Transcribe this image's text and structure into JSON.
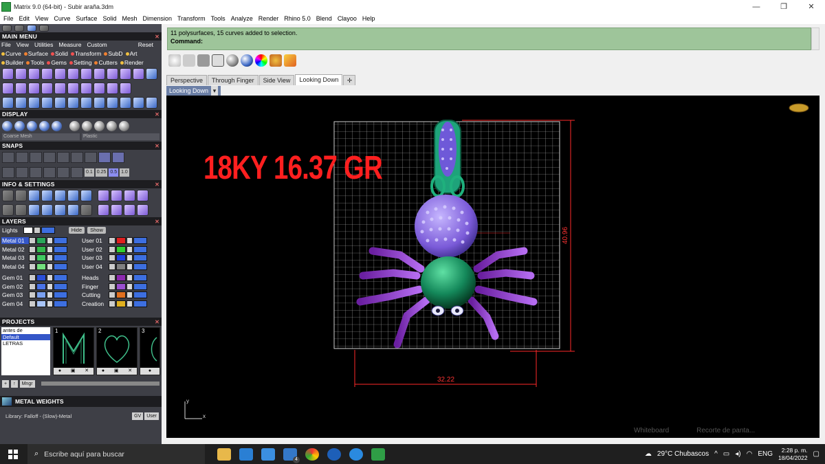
{
  "window": {
    "title": "Matrix 9.0 (64-bit) - Subir araña.3dm",
    "minimize": "—",
    "maximize": "❐",
    "close": "✕"
  },
  "menubar": [
    "File",
    "Edit",
    "View",
    "Curve",
    "Surface",
    "Solid",
    "Mesh",
    "Dimension",
    "Transform",
    "Tools",
    "Analyze",
    "Render",
    "Rhino 5.0",
    "Blend",
    "Clayoo",
    "Help"
  ],
  "left": {
    "main_menu_title": "MAIN MENU",
    "main_menu_row": [
      "File",
      "View",
      "Utilities",
      "Measure",
      "Custom"
    ],
    "reset": "Reset",
    "chips1": [
      "Curve",
      "Surface",
      "Solid",
      "Transform",
      "SubD",
      "Art"
    ],
    "chips2": [
      "Builder",
      "Tools",
      "Gems",
      "Setting",
      "Cutters",
      "Render"
    ],
    "display_title": "DISPLAY",
    "display_select1": "Coarse Mesh",
    "display_select2": "Plastic",
    "snaps_title": "SNAPS",
    "snap_values": [
      "0.1",
      "0.25",
      "0.5",
      "1.0"
    ],
    "info_title": "INFO & SETTINGS",
    "layers_title": "LAYERS",
    "lights": "Lights",
    "hide": "Hide",
    "show": "Show",
    "layers_left": [
      {
        "name": "Metal 01",
        "color": "#2aa65a",
        "sel": true
      },
      {
        "name": "Metal 02",
        "color": "#32b74c",
        "sel": false
      },
      {
        "name": "Metal 03",
        "color": "#3fc960",
        "sel": false
      },
      {
        "name": "Metal 04",
        "color": "#73e07d",
        "sel": false
      },
      {
        "name": "Gem 01",
        "color": "#2a4fd8",
        "sel": false
      },
      {
        "name": "Gem 02",
        "color": "#4a73e8",
        "sel": false
      },
      {
        "name": "Gem 03",
        "color": "#7aa0f0",
        "sel": false
      },
      {
        "name": "Gem 04",
        "color": "#a8c4f7",
        "sel": false
      }
    ],
    "layers_right": [
      {
        "name": "User 01",
        "color": "#e02020"
      },
      {
        "name": "User 02",
        "color": "#30d030"
      },
      {
        "name": "User 03",
        "color": "#2040e0"
      },
      {
        "name": "User 04",
        "color": "#808080"
      },
      {
        "name": "Heads",
        "color": "#8c2ab0"
      },
      {
        "name": "Finger",
        "color": "#9a4fd0"
      },
      {
        "name": "Cutting",
        "color": "#e07020"
      },
      {
        "name": "Creation",
        "color": "#e0b020"
      }
    ],
    "projects_title": "PROJECTS",
    "projects": [
      "antes de",
      "Default",
      "LETRAS"
    ],
    "thumb_numbers": [
      "1",
      "2",
      "3"
    ],
    "mngr": "Mngr",
    "metal_weights_title": "METAL WEIGHTS",
    "library": "Library: Falloff - (Slow)-Metal",
    "gv": "GV",
    "user": "User"
  },
  "command": {
    "line1": "11 polysurfaces, 15 curves added to selection.",
    "line2": "Command:"
  },
  "tabs": [
    "Perspective",
    "Through Finger",
    "Side View",
    "Looking Down",
    "✛"
  ],
  "active_tab": "Looking Down",
  "view_label": "Looking Down",
  "viewport": {
    "watermark": "18KY 16.37 GR",
    "dim_width": "32.22",
    "dim_height": "40.96",
    "axis_y": "y",
    "axis_x": "x",
    "ghost1": "Whiteboard",
    "ghost2": "Recorte de panta..."
  },
  "taskbar": {
    "search_placeholder": "Escribe aquí para buscar",
    "weather": "29°C  Chubascos",
    "lang": "ENG",
    "time": "2:28 p. m.",
    "date": "18/04/2022",
    "mail_badge": "4"
  }
}
